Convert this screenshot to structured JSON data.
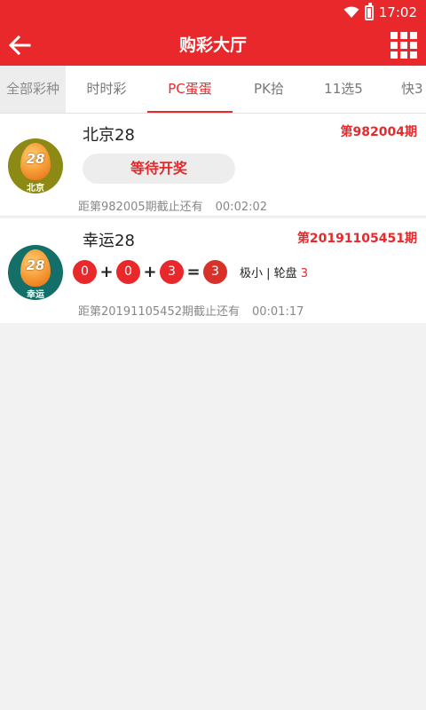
{
  "status_bar": {
    "time": "17:02",
    "icons": [
      "wifi-icon",
      "battery-charging-icon"
    ]
  },
  "header": {
    "title": "购彩大厅",
    "back_icon": "back-arrow-icon",
    "menu_icon": "grid-menu-icon"
  },
  "colors": {
    "brand_red": "#e8282b",
    "muted_text": "#888888"
  },
  "tabs": [
    {
      "label": "全部彩种"
    },
    {
      "label": "时时彩"
    },
    {
      "label": "PC蛋蛋"
    },
    {
      "label": "PK拾"
    },
    {
      "label": "11选5"
    },
    {
      "label": "快3"
    }
  ],
  "active_tab": "PC蛋蛋",
  "lotteries": [
    {
      "name": "北京28",
      "icon_number": "28",
      "icon_label": "北京",
      "issue": "第982004期",
      "status_button": "等待开奖",
      "countdown_label": "距第982005期截止还有",
      "countdown_time": "00:02:02"
    },
    {
      "name": "幸运28",
      "icon_number": "28",
      "icon_label": "幸运",
      "issue": "第20191105451期",
      "draw": {
        "balls": [
          "0",
          "0",
          "3"
        ],
        "plus": "+",
        "equals": "=",
        "sum": "3",
        "result_text": "极小 | 轮盘",
        "result_number": "3"
      },
      "countdown_label": "距第20191105452期截止还有",
      "countdown_time": "00:01:17"
    }
  ]
}
